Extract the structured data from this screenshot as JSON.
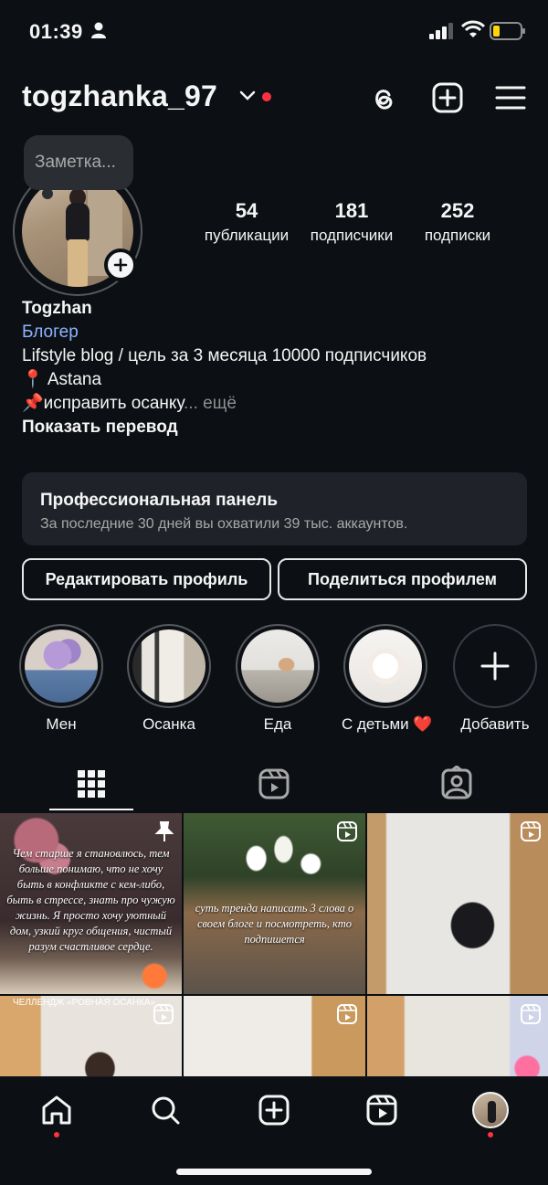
{
  "status_bar": {
    "time": "01:39"
  },
  "header": {
    "username": "togzhanka_97"
  },
  "note": {
    "placeholder": "Заметка..."
  },
  "stats": [
    {
      "value": "54",
      "label": "публикации"
    },
    {
      "value": "181",
      "label": "подписчики"
    },
    {
      "value": "252",
      "label": "подписки"
    }
  ],
  "bio": {
    "name": "Togzhan",
    "category": "Блогер",
    "line1": "Lifstyle blog / цель за 3 месяца 10000 подписчиков",
    "line2": "📍 Astana",
    "line3": "📌исправить осанку",
    "more": "... ещё",
    "translate": "Показать перевод"
  },
  "dashboard": {
    "title": "Профессиональная панель",
    "subtitle": "За последние 30 дней вы охватили 39 тыс. аккаунтов."
  },
  "buttons": {
    "edit": "Редактировать профиль",
    "share": "Поделиться профилем"
  },
  "highlights": [
    {
      "label": "Мен"
    },
    {
      "label": "Осанка"
    },
    {
      "label": "Еда"
    },
    {
      "label": "С детьми ❤️"
    },
    {
      "label": "Добавить"
    }
  ],
  "posts": {
    "post1_text": "Чем старше я становлюсь, тем больше понимаю, что не хочу быть в конфликте с кем-либо, быть в стрессе, знать про чужую жизнь. Я просто хочу уютный дом, узкий круг общения, чистый разум счастливое сердце.",
    "post2_text": "суть тренда написать 3 слова о своем блоге и посмотреть, кто подпишется",
    "post4_caption": "ЧЕЛЛЕНДЖ «РОВНАЯ ОСАНКА»"
  },
  "colors": {
    "background": "#0c1014",
    "accent_red": "#ff3040",
    "link_blue": "#8eb3ff",
    "card": "#1f2329"
  },
  "icons": [
    "threads-icon",
    "new-post-icon",
    "menu-icon",
    "grid-icon",
    "reels-icon",
    "tagged-icon",
    "home-icon",
    "search-icon",
    "create-icon",
    "reels-nav-icon"
  ]
}
